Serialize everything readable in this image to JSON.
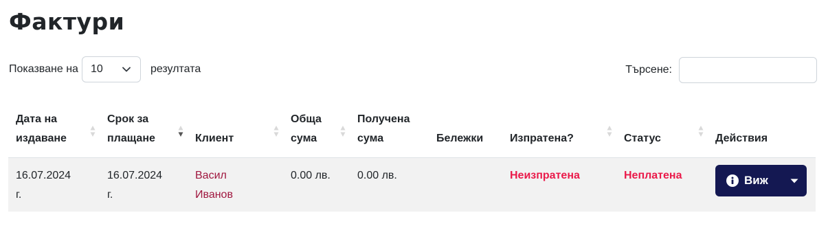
{
  "page": {
    "title": "Фактури"
  },
  "length_control": {
    "prefix": "Показване на",
    "selected": "10",
    "suffix": "резултата"
  },
  "search": {
    "label": "Търсене:",
    "value": "",
    "placeholder": ""
  },
  "table": {
    "headers": [
      {
        "line1": "Дата на",
        "line2": "издаване",
        "sortable": true,
        "sort": "none"
      },
      {
        "line1": "Срок за",
        "line2": "плащане",
        "sortable": true,
        "sort": "desc"
      },
      {
        "line1": "",
        "line2": "Клиент",
        "sortable": true,
        "sort": "none"
      },
      {
        "line1": "Обща",
        "line2": "сума",
        "sortable": true,
        "sort": "none"
      },
      {
        "line1": "Получена",
        "line2": "сума",
        "sortable": false,
        "sort": "none"
      },
      {
        "line1": "",
        "line2": "Бележки",
        "sortable": false,
        "sort": "none"
      },
      {
        "line1": "",
        "line2": "Изпратена?",
        "sortable": true,
        "sort": "none"
      },
      {
        "line1": "",
        "line2": "Статус",
        "sortable": true,
        "sort": "none"
      },
      {
        "line1": "",
        "line2": "Действия",
        "sortable": false,
        "sort": "none"
      }
    ],
    "rows": [
      {
        "issue_date_line1": "16.07.2024",
        "issue_date_line2": "г.",
        "due_date_line1": "16.07.2024",
        "due_date_line2": "г.",
        "client_line1": "Васил",
        "client_line2": "Иванов",
        "total": "0.00 лв.",
        "received": "0.00 лв.",
        "notes": "",
        "sent": "Неизпратена",
        "status": "Неплатена",
        "action_label": "Виж"
      }
    ]
  },
  "colors": {
    "accent_dark": "#141852",
    "status_red": "#ea1a4a",
    "client_link": "#a0173f",
    "row_bg": "#f2f2f2"
  },
  "icons": {
    "select_arrow": "chevron-down-icon",
    "action": "info-circle-icon",
    "dropdown": "caret-down-icon",
    "sort": "sort-arrows-icon"
  }
}
